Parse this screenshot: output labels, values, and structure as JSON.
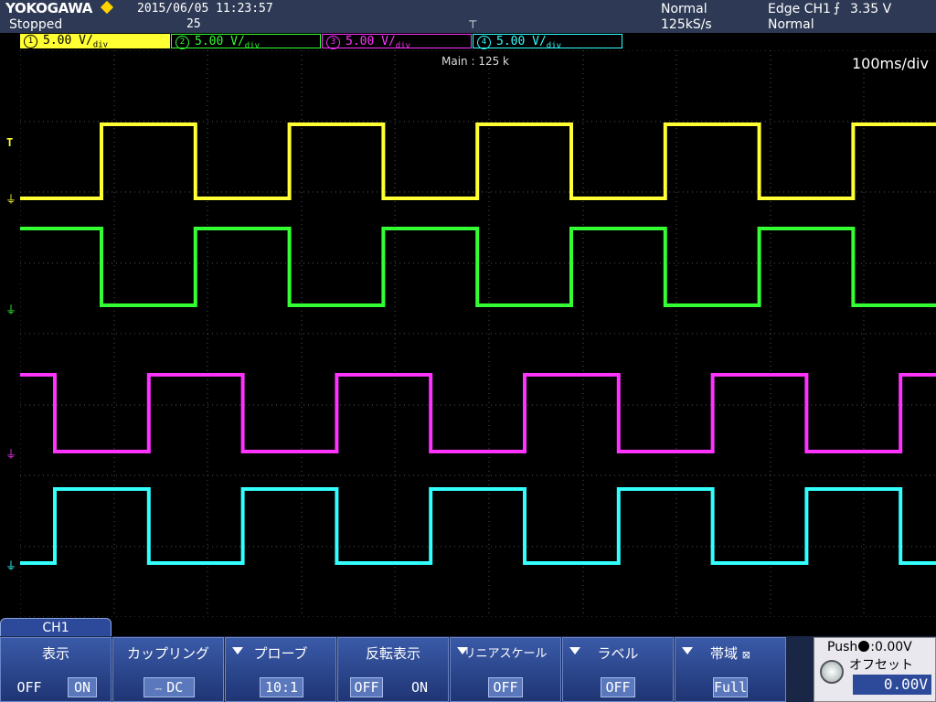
{
  "header": {
    "brand": "YOKOGAWA",
    "status": "Stopped",
    "datetime": "2015/06/05 11:23:57",
    "acq_count": "25",
    "acq_mode": "Normal",
    "sample_rate": "125kS/s",
    "trigger": "Edge CH1",
    "trigger_level": "3.35 V",
    "trigger_mode": "Normal"
  },
  "channels": [
    {
      "num": "1",
      "scale": "5.00 V",
      "unit": "div",
      "color": "#ffff33"
    },
    {
      "num": "2",
      "scale": "5.00 V",
      "unit": "div",
      "color": "#33ff33"
    },
    {
      "num": "3",
      "scale": "5.00 V",
      "unit": "div",
      "color": "#ff33ff"
    },
    {
      "num": "4",
      "scale": "5.00 V",
      "unit": "div",
      "color": "#33ffff"
    }
  ],
  "display": {
    "main_label": "Main : 125 k",
    "timebase": "100ms/div"
  },
  "menu": {
    "tab": "CH1",
    "items": [
      {
        "label": "表示",
        "opt_a": "OFF",
        "opt_b": "ON",
        "selected": "ON"
      },
      {
        "label": "カップリング",
        "value": "DC"
      },
      {
        "label": "プローブ",
        "value": "10:1"
      },
      {
        "label": "反転表示",
        "opt_a": "OFF",
        "opt_b": "ON",
        "selected": "OFF"
      },
      {
        "label": "リニアスケール",
        "value": "OFF"
      },
      {
        "label": "ラベル",
        "value": "OFF"
      },
      {
        "label": "帯域",
        "value": "Full"
      }
    ],
    "offset_push": "Push",
    "offset_push_value": ":0.00V",
    "offset_label": "オフセット",
    "offset_value": "0.00V"
  }
}
